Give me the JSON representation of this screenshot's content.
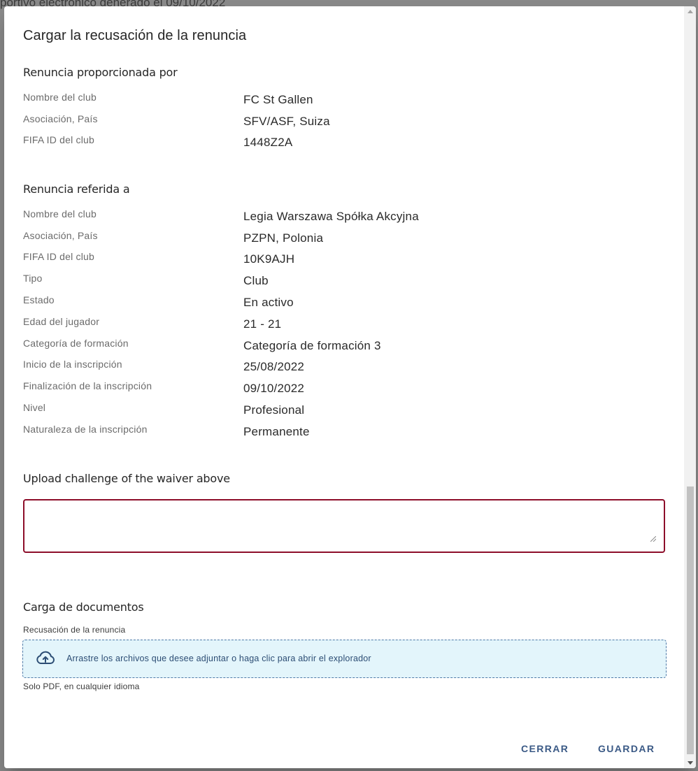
{
  "background": {
    "header_text": "portivo electrónico generado el 09/10/2022"
  },
  "dialog": {
    "title": "Cargar la recusación de la renuncia",
    "provided_by": {
      "heading": "Renuncia proporcionada por",
      "rows": [
        {
          "label": "Nombre del club",
          "value": "FC St Gallen"
        },
        {
          "label": "Asociación, País",
          "value": "SFV/ASF, Suiza"
        },
        {
          "label": "FIFA ID del club",
          "value": "1448Z2A"
        }
      ]
    },
    "referred_to": {
      "heading": "Renuncia referida a",
      "rows": [
        {
          "label": "Nombre del club",
          "value": "Legia Warszawa Spółka Akcyjna"
        },
        {
          "label": "Asociación, País",
          "value": "PZPN, Polonia"
        },
        {
          "label": "FIFA ID del club",
          "value": "10K9AJH"
        },
        {
          "label": "Tipo",
          "value": "Club"
        },
        {
          "label": "Estado",
          "value": "En activo"
        },
        {
          "label": "Edad del jugador",
          "value": "21 - 21"
        },
        {
          "label": "Categoría de formación",
          "value": "Categoría de formación 3"
        },
        {
          "label": "Inicio de la inscripción",
          "value": "25/08/2022"
        },
        {
          "label": "Finalización de la inscripción",
          "value": "09/10/2022"
        },
        {
          "label": "Nivel",
          "value": "Profesional"
        },
        {
          "label": "Naturaleza de la inscripción",
          "value": "Permanente"
        }
      ]
    },
    "challenge": {
      "heading": "Upload challenge of the waiver above",
      "textarea_value": ""
    },
    "documents": {
      "heading": "Carga de documentos",
      "field_label": "Recusación de la renuncia",
      "dropzone_text": "Arrastre los archivos que desee adjuntar o haga clic para abrir el explorador",
      "dropzone_icon": "cloud-upload-icon",
      "hint": "Solo PDF, en cualquier idioma"
    },
    "actions": {
      "close_label": "CERRAR",
      "save_label": "GUARDAR"
    },
    "colors": {
      "accent": "#3b5a86",
      "error_border": "#8d0e2a",
      "dropzone_bg": "#e3f5fb"
    }
  }
}
